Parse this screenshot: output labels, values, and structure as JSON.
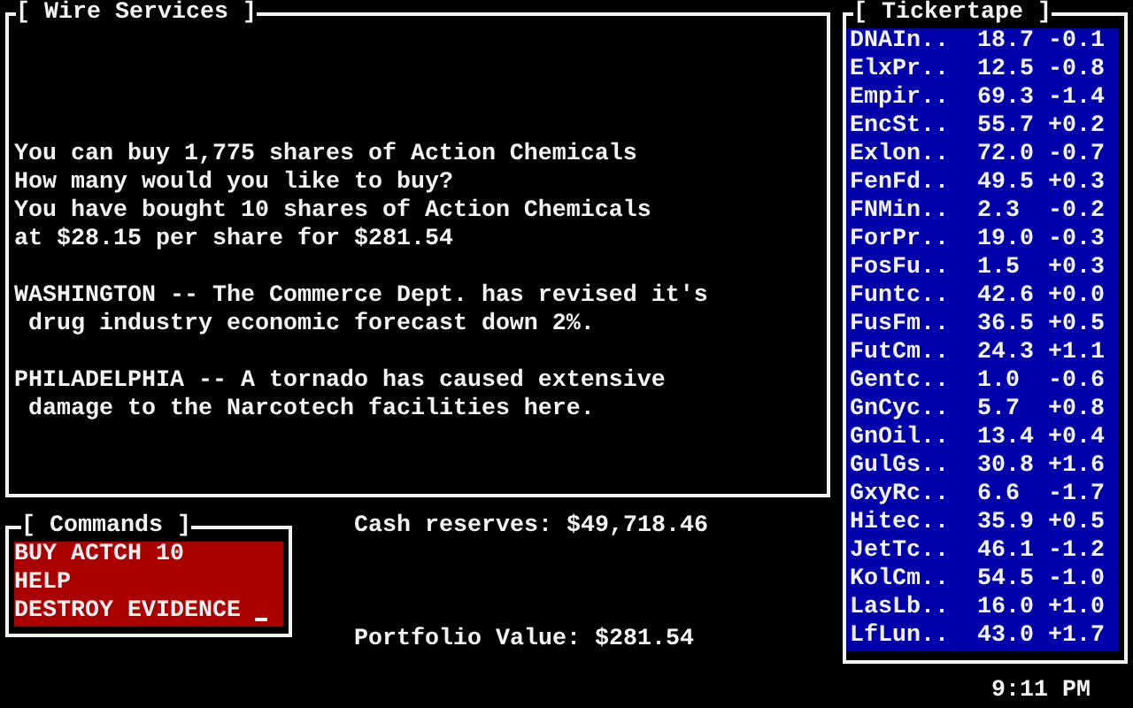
{
  "wire_services": {
    "title": "[ Wire Services ]",
    "paragraphs": [
      {
        "lines": [
          "You can buy 1,775 shares of Action Chemicals",
          "How many would you like to buy?",
          "You have bought 10 shares of Action Chemicals",
          "at $28.15 per share for $281.54"
        ]
      },
      {
        "lines": [
          "WASHINGTON -- The Commerce Dept. has revised it's",
          " drug industry economic forecast down 2%."
        ]
      },
      {
        "lines": [
          "PHILADELPHIA -- A tornado has caused extensive",
          " damage to the Narcotech facilities here."
        ]
      }
    ]
  },
  "commands": {
    "title": "[ Commands ]",
    "history": [
      "BUY ACTCH 10",
      "HELP"
    ],
    "input": {
      "value": "DESTROY EVIDENCE "
    }
  },
  "cash_reserves": "Cash reserves: $49,718.46",
  "portfolio_value": "Portfolio Value: $281.54",
  "tickertape": {
    "title": "[ Tickertape ]",
    "rows": [
      {
        "name": "DNAIn..",
        "price": "18.7",
        "change": "-0.1"
      },
      {
        "name": "ElxPr..",
        "price": "12.5",
        "change": "-0.8"
      },
      {
        "name": "Empir..",
        "price": "69.3",
        "change": "-1.4"
      },
      {
        "name": "EncSt..",
        "price": "55.7",
        "change": "+0.2"
      },
      {
        "name": "Exlon..",
        "price": "72.0",
        "change": "-0.7"
      },
      {
        "name": "FenFd..",
        "price": "49.5",
        "change": "+0.3"
      },
      {
        "name": "FNMin..",
        "price": "2.3",
        "change": "-0.2"
      },
      {
        "name": "ForPr..",
        "price": "19.0",
        "change": "-0.3"
      },
      {
        "name": "FosFu..",
        "price": "1.5",
        "change": "+0.3"
      },
      {
        "name": "Funtc..",
        "price": "42.6",
        "change": "+0.0"
      },
      {
        "name": "FusFm..",
        "price": "36.5",
        "change": "+0.5"
      },
      {
        "name": "FutCm..",
        "price": "24.3",
        "change": "+1.1"
      },
      {
        "name": "Gentc..",
        "price": "1.0",
        "change": "-0.6"
      },
      {
        "name": "GnCyc..",
        "price": "5.7",
        "change": "+0.8"
      },
      {
        "name": "GnOil..",
        "price": "13.4",
        "change": "+0.4"
      },
      {
        "name": "GulGs..",
        "price": "30.8",
        "change": "+1.6"
      },
      {
        "name": "GxyRc..",
        "price": "6.6",
        "change": "-1.7"
      },
      {
        "name": "Hitec..",
        "price": "35.9",
        "change": "+0.5"
      },
      {
        "name": "JetTc..",
        "price": "46.1",
        "change": "-1.2"
      },
      {
        "name": "KolCm..",
        "price": "54.5",
        "change": "-1.0"
      },
      {
        "name": "LasLb..",
        "price": "16.0",
        "change": "+1.0"
      },
      {
        "name": "LfLun..",
        "price": "43.0",
        "change": "+1.7"
      }
    ]
  },
  "clock": "9:11 PM"
}
